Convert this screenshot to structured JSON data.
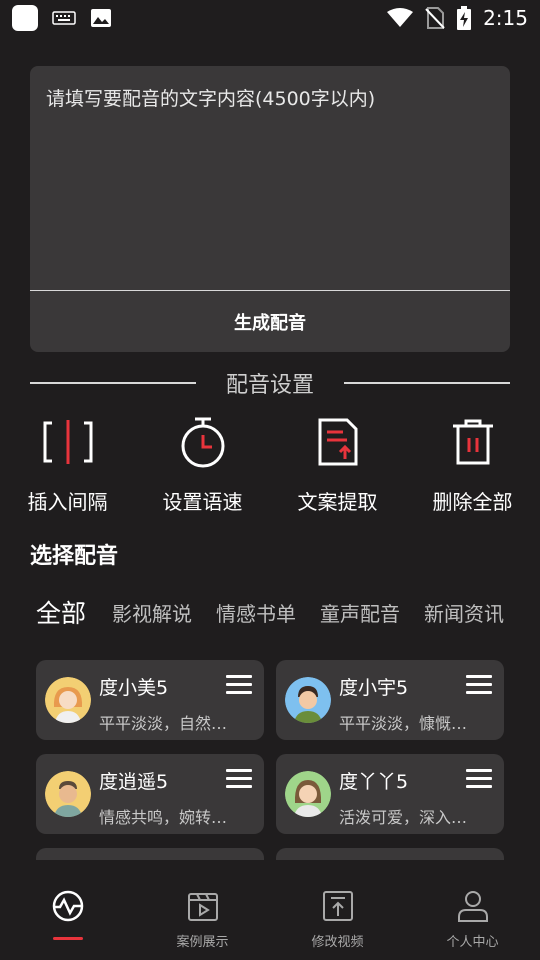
{
  "status_bar": {
    "time": "2:15"
  },
  "editor": {
    "placeholder": "请填写要配音的文字内容(4500字以内)",
    "generate_label": "生成配音"
  },
  "settings_title": "配音设置",
  "tools": [
    {
      "label": "插入间隔",
      "icon": "insert-interval-icon"
    },
    {
      "label": "设置语速",
      "icon": "timer-icon"
    },
    {
      "label": "文案提取",
      "icon": "extract-text-icon"
    },
    {
      "label": "删除全部",
      "icon": "trash-icon"
    }
  ],
  "choose_title": "选择配音",
  "categories": {
    "active": "全部",
    "items": [
      "影视解说",
      "情感书单",
      "童声配音",
      "新闻资讯"
    ]
  },
  "voices": [
    {
      "name": "度小美5",
      "desc": "平平淡淡，自然…"
    },
    {
      "name": "度小宇5",
      "desc": "平平淡淡，慷慨…"
    },
    {
      "name": "度逍遥5",
      "desc": "情感共鸣，婉转…"
    },
    {
      "name": "度丫丫5",
      "desc": "活泼可爱，深入…"
    }
  ],
  "bottom_nav": [
    {
      "label": "",
      "icon": "waveform-icon",
      "active": true
    },
    {
      "label": "案例展示",
      "icon": "play-board-icon"
    },
    {
      "label": "修改视频",
      "icon": "upload-box-icon"
    },
    {
      "label": "个人中心",
      "icon": "person-icon"
    }
  ],
  "colors": {
    "accent": "#e8343c",
    "card": "#3a3839",
    "background": "#1f1d1e"
  }
}
